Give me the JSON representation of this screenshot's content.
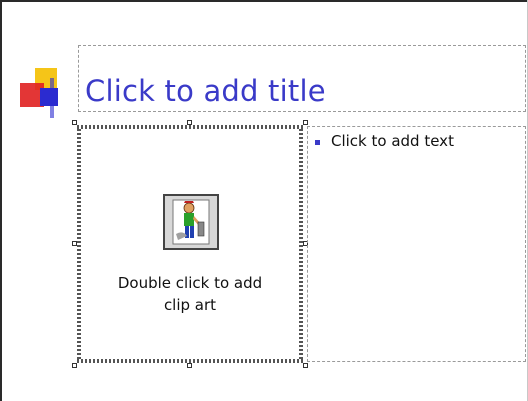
{
  "slide": {
    "title_placeholder": "Click to add title",
    "clipart_placeholder": "Double click to add\nclip art",
    "text_placeholder": "Click to add text"
  },
  "icons": {
    "logo": "office-logo-icon",
    "clipart": "clip-art-icon",
    "bullet": "square-bullet-icon"
  },
  "colors": {
    "title": "#3a3ac8",
    "bullet": "#3a3ac8",
    "logo_yellow": "#f5c518",
    "logo_red": "#e02020",
    "logo_blue": "#2b2bd0"
  }
}
